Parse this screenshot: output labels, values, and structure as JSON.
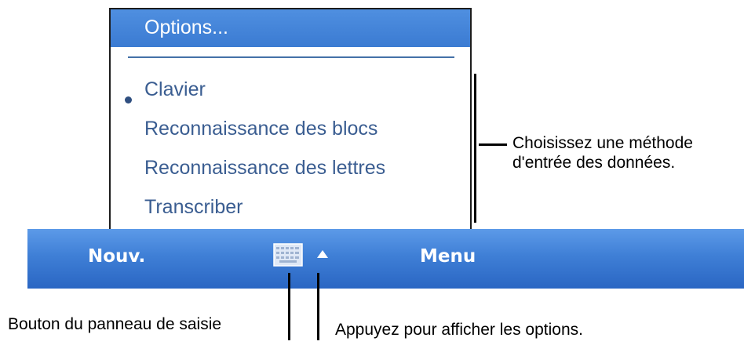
{
  "menu": {
    "header": "Options...",
    "items": [
      {
        "label": "Clavier",
        "selected": true
      },
      {
        "label": "Reconnaissance des blocs",
        "selected": false
      },
      {
        "label": "Reconnaissance des lettres",
        "selected": false
      },
      {
        "label": "Transcriber",
        "selected": false
      }
    ]
  },
  "softbar": {
    "left_label": "Nouv.",
    "right_label": "Menu",
    "input_panel_icon": "keyboard-icon",
    "options_icon": "triangle-up-icon"
  },
  "callouts": {
    "input_method_line1": "Choisissez une méthode",
    "input_method_line2": "d'entrée des données.",
    "input_panel_button": "Bouton du panneau de saisie",
    "show_options": "Appuyez pour afficher les options."
  },
  "colors": {
    "menu_header": "#3b7bd2",
    "menu_text": "#3a5d91",
    "softbar": "#3f7fd6"
  }
}
